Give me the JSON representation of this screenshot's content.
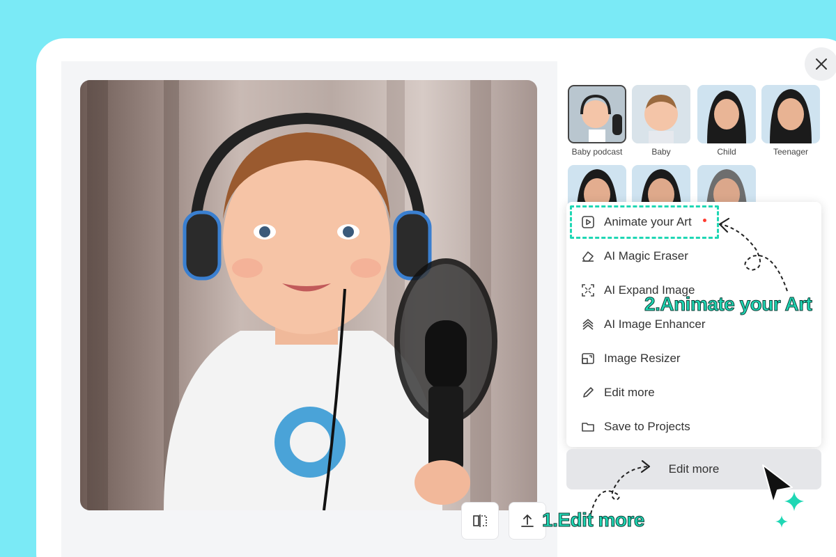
{
  "styles": {
    "thumbnails": [
      {
        "label": "Baby podcast",
        "selected": true
      },
      {
        "label": "Baby",
        "selected": false
      },
      {
        "label": "Child",
        "selected": false
      },
      {
        "label": "Teenager",
        "selected": false
      },
      {
        "label": "",
        "selected": false
      },
      {
        "label": "",
        "selected": false
      },
      {
        "label": "",
        "selected": false
      }
    ]
  },
  "menu": {
    "items": [
      {
        "label": "Animate your Art",
        "icon": "play-frame-icon",
        "has_dot": true
      },
      {
        "label": "AI Magic Eraser",
        "icon": "eraser-icon"
      },
      {
        "label": "AI Expand Image",
        "icon": "expand-icon"
      },
      {
        "label": "AI Image Enhancer",
        "icon": "enhance-icon"
      },
      {
        "label": "Image Resizer",
        "icon": "resize-icon"
      },
      {
        "label": "Edit more",
        "icon": "pencil-icon"
      },
      {
        "label": "Save to Projects",
        "icon": "folder-icon"
      }
    ]
  },
  "edit_button": {
    "label": "Edit more"
  },
  "annotations": {
    "step1": "1.Edit more",
    "step2": "2.Animate your Art"
  },
  "colors": {
    "background": "#7aeaf6",
    "accent": "#1fd7b4",
    "panel": "#ffffff"
  }
}
